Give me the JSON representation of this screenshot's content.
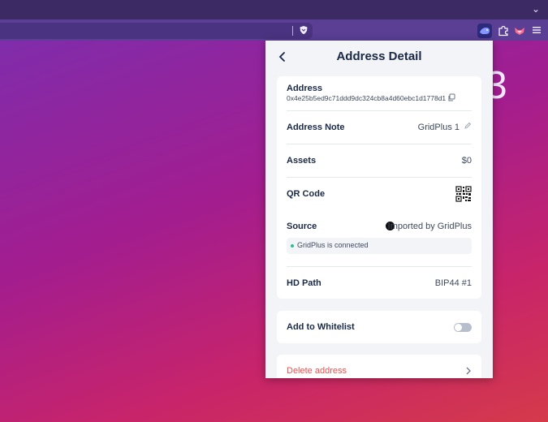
{
  "browser": {
    "background_digit": "3"
  },
  "panel": {
    "title": "Address Detail",
    "address": {
      "label": "Address",
      "value": "0x4e25b5ed9c71ddd9dc324cb8a4d60ebc1d1778d1"
    },
    "note": {
      "label": "Address Note",
      "value": "GridPlus 1"
    },
    "assets": {
      "label": "Assets",
      "value": "$0"
    },
    "qr": {
      "label": "QR Code"
    },
    "source": {
      "label": "Source",
      "value": "Imported by GridPlus",
      "status": "GridPlus is connected"
    },
    "hd_path": {
      "label": "HD Path",
      "value": "BIP44 #1"
    },
    "whitelist": {
      "label": "Add to Whitelist",
      "enabled": false
    },
    "delete": {
      "label": "Delete address"
    }
  },
  "colors": {
    "accent": "#7084ff",
    "danger": "#ec5151",
    "success": "#27c193",
    "text": "#192945"
  }
}
